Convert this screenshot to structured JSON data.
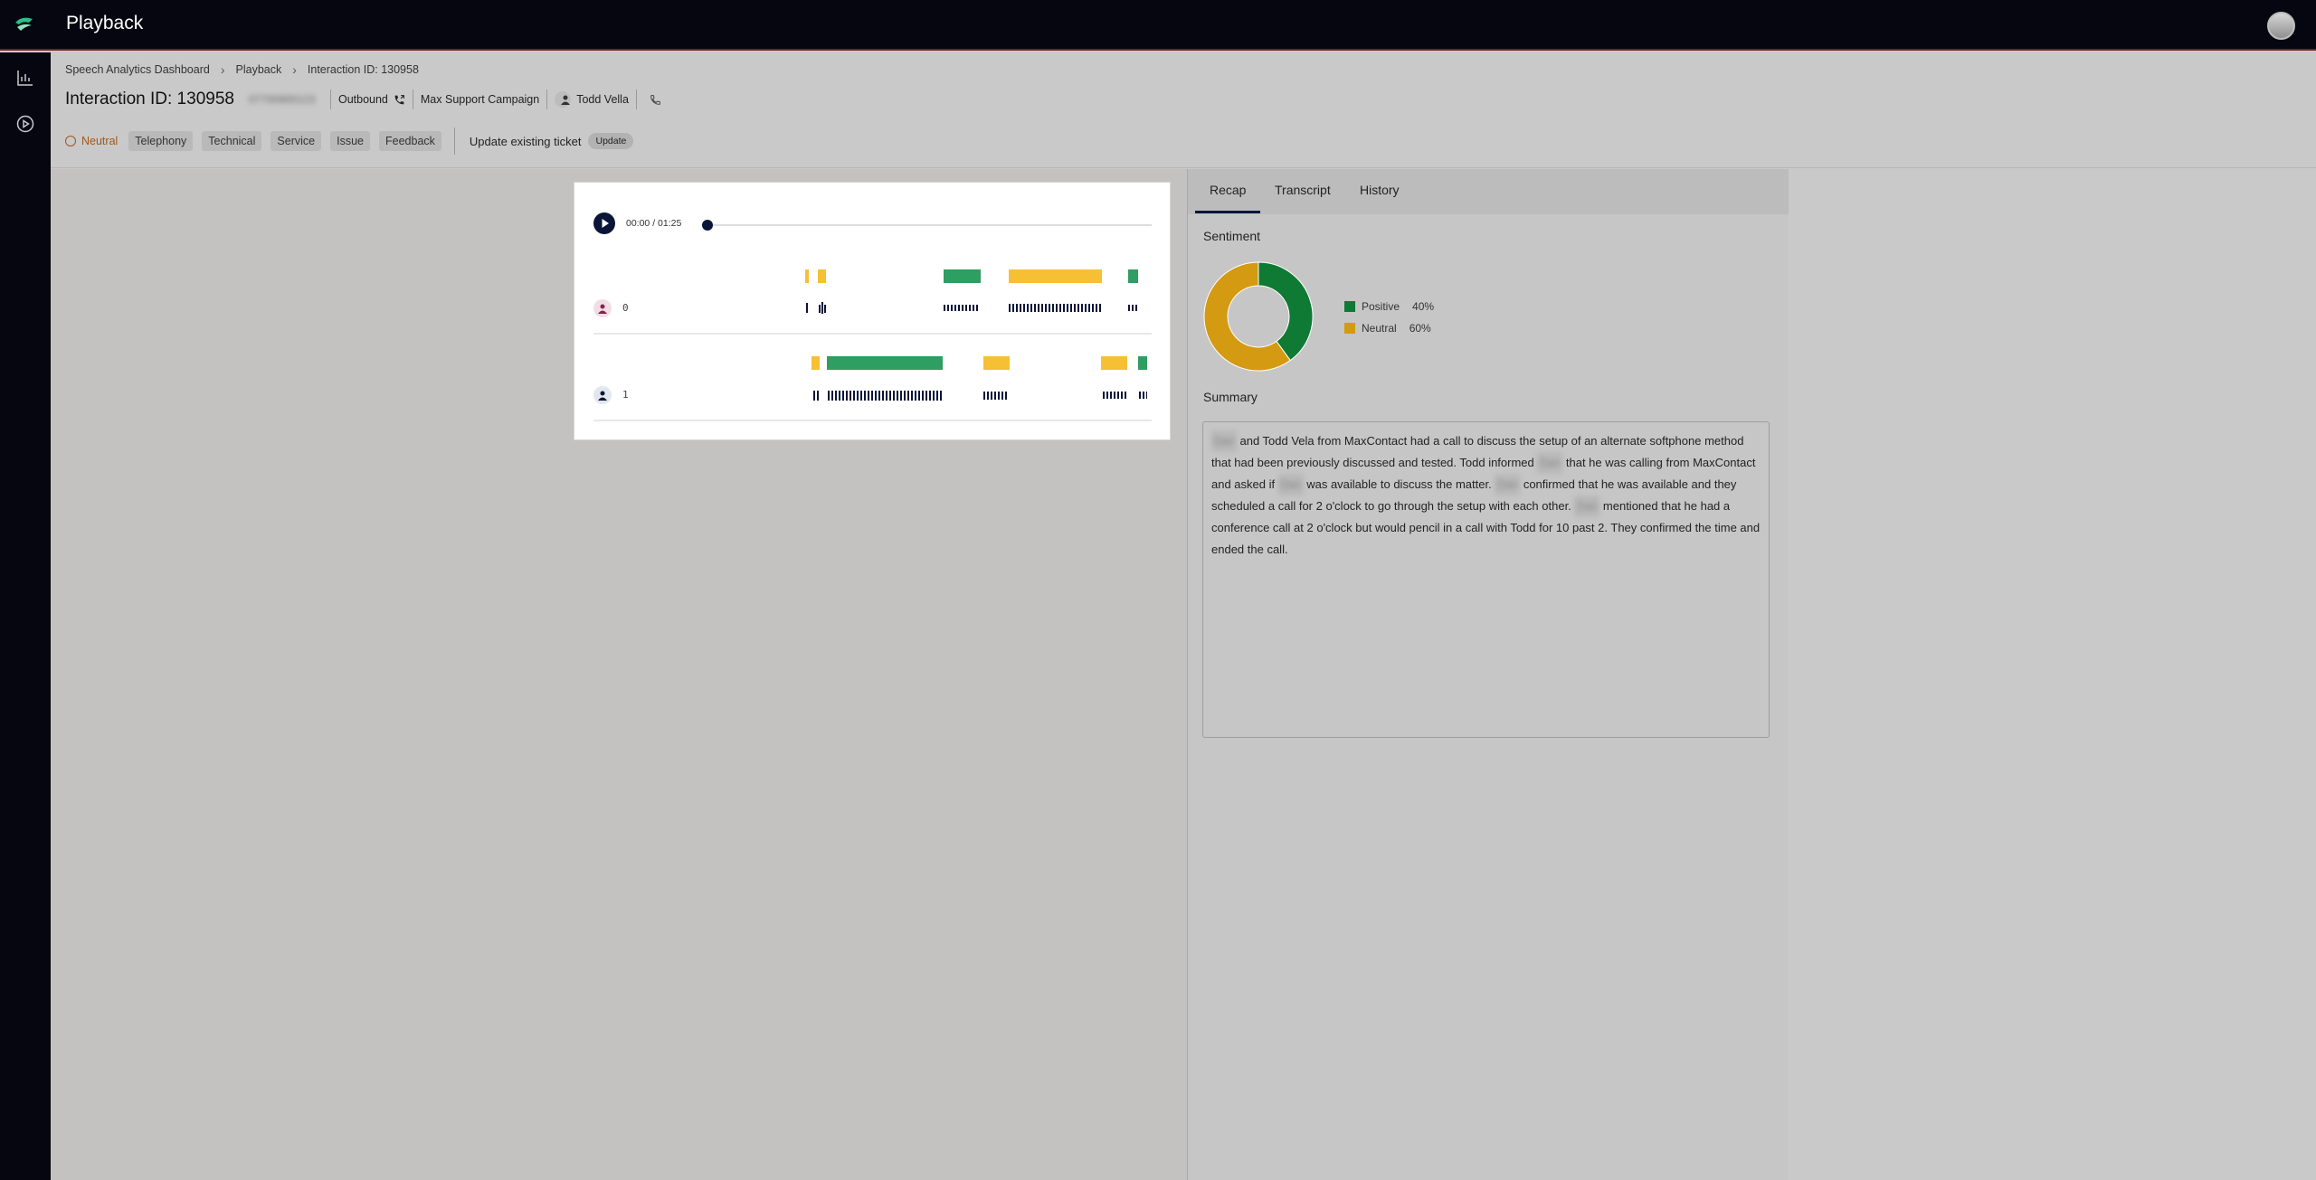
{
  "app": {
    "title": "Playback",
    "logo_icon": "brand-logo-icon",
    "avatar_icon": "user-avatar-icon"
  },
  "sidebar": {
    "items": [
      {
        "icon": "bar-chart-icon"
      },
      {
        "icon": "play-circle-icon"
      }
    ]
  },
  "breadcrumb": {
    "items": [
      "Speech Analytics Dashboard",
      "Playback",
      "Interaction ID: 130958"
    ]
  },
  "header": {
    "title": "Interaction ID: 130958",
    "phone_blurred": "07700900123",
    "direction": "Outbound",
    "campaign": "Max Support Campaign",
    "agent": "Todd Vella"
  },
  "tags": {
    "sentiment": "Neutral",
    "items": [
      "Telephony",
      "Technical",
      "Service",
      "Issue",
      "Feedback"
    ],
    "ticket_label": "Update existing ticket",
    "update_button": "Update"
  },
  "player": {
    "time": "00:00 / 01:25",
    "progress": 0,
    "speakers": [
      {
        "label": "0"
      },
      {
        "label": "1"
      }
    ]
  },
  "panel": {
    "tabs": [
      "Recap",
      "Transcript",
      "History"
    ],
    "active_tab": "Recap",
    "sentiment_title": "Sentiment",
    "legend": [
      {
        "name": "Positive",
        "pct": "40%",
        "value": 40,
        "color": "#0e7a33"
      },
      {
        "name": "Neutral",
        "pct": "60%",
        "value": 60,
        "color": "#d39a12"
      }
    ],
    "summary_title": "Summary",
    "summary": {
      "p1": "and Todd Vela from MaxContact had a call to discuss the setup of an alternate softphone method that had been previously discussed and tested. Todd informed",
      "p2": "that he was calling from MaxContact and asked if",
      "p3": "was available to discuss the matter.",
      "p4": "confirmed that he was available and they scheduled a call for 2 o'clock to go through the setup with each other.",
      "p5": "mentioned that he had a conference call at 2 o'clock but would pencil in a call with Todd for 10 past 2. They confirmed the time and ended the call.",
      "blurred_name": "Dan"
    }
  },
  "colors": {
    "positive": "#2e9e63",
    "neutral": "#f5c033",
    "navy": "#0a1538"
  }
}
